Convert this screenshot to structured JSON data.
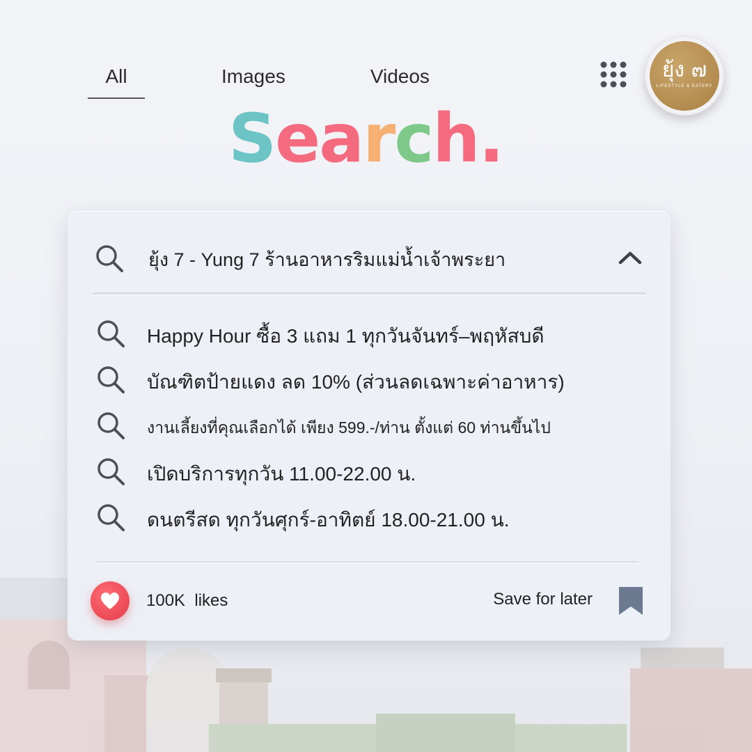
{
  "tabs": {
    "all": "All",
    "images": "Images",
    "videos": "Videos"
  },
  "logo": {
    "mark": "ยุ้ง ๗",
    "sub": "LIFESTYLE & EATERY"
  },
  "title": {
    "letters": [
      "S",
      "e",
      "a",
      "r",
      "c",
      "h",
      "."
    ],
    "colors": [
      "#6cc4c4",
      "#f46a7e",
      "#f46a7e",
      "#f7b074",
      "#7ec98a",
      "#f46a7e",
      "#f46a7e"
    ]
  },
  "card": {
    "query": "ยุ้ง 7 - Yung 7 ร้านอาหารริมแม่น้ำเจ้าพระยา",
    "suggestions": [
      "Happy Hour ซื้อ 3 แถม 1 ทุกวันจันทร์–พฤหัสบดี",
      "บัณฑิตป้ายแดง ลด 10% (ส่วนลดเฉพาะค่าอาหาร)",
      "งานเลี้ยงที่คุณเลือกได้ เพียง 599.-/ท่าน ตั้งแต่ 60  ท่านขึ้นไป",
      "เปิดบริการทุกวัน 11.00-22.00 น.",
      "ดนตรีสด ทุกวันศุกร์-อาทิตย์ 18.00-21.00 น."
    ],
    "likes": "100K  likes",
    "save_label": "Save for later"
  },
  "colors": {
    "accent_heart": "#e84550",
    "bookmark": "#6b7a90",
    "icon_gray": "#4a4f58"
  },
  "icons": [
    "search-icon",
    "apps-grid-icon",
    "chevron-up-icon",
    "heart-icon",
    "bookmark-icon"
  ]
}
